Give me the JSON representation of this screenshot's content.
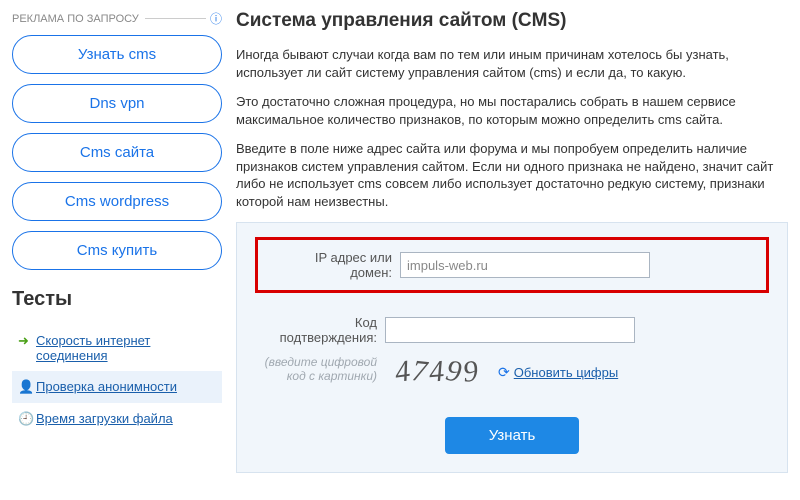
{
  "sidebar": {
    "ad_header": "РЕКЛАМА ПО ЗАПРОСУ",
    "ads": [
      "Узнать cms",
      "Dns vpn",
      "Cms сайта",
      "Cms wordpress",
      "Cms купить"
    ],
    "tests_heading": "Тесты",
    "tests": [
      {
        "label": "Скорость интернет соединения"
      },
      {
        "label": "Проверка анонимности"
      },
      {
        "label": "Время загрузки файла"
      }
    ]
  },
  "main": {
    "title": "Система управления сайтом (CMS)",
    "p1": "Иногда бывают случаи когда вам по тем или иным причинам хотелось бы узнать, использует ли сайт систему управления сайтом (cms) и если да, то какую.",
    "p2": "Это достаточно сложная процедура, но мы постарались собрать в нашем сервисе максимальное количество признаков, по которым можно определить cms сайта.",
    "p3": "Введите в поле ниже адрес сайта или форума и мы попробуем определить наличие признаков систем управления сайтом. Если ни одного признака не найдено, значит сайт либо не использует cms совсем либо использует достаточно редкую систему, признаки которой нам неизвестны."
  },
  "form": {
    "ip_label": "IP адрес или домен:",
    "ip_value": "impuls-web.ru",
    "code_label": "Код подтверждения:",
    "code_value": "",
    "hint": "(введите цифровой код с картинки)",
    "captcha": "47499",
    "refresh": "Обновить цифры",
    "submit": "Узнать"
  }
}
